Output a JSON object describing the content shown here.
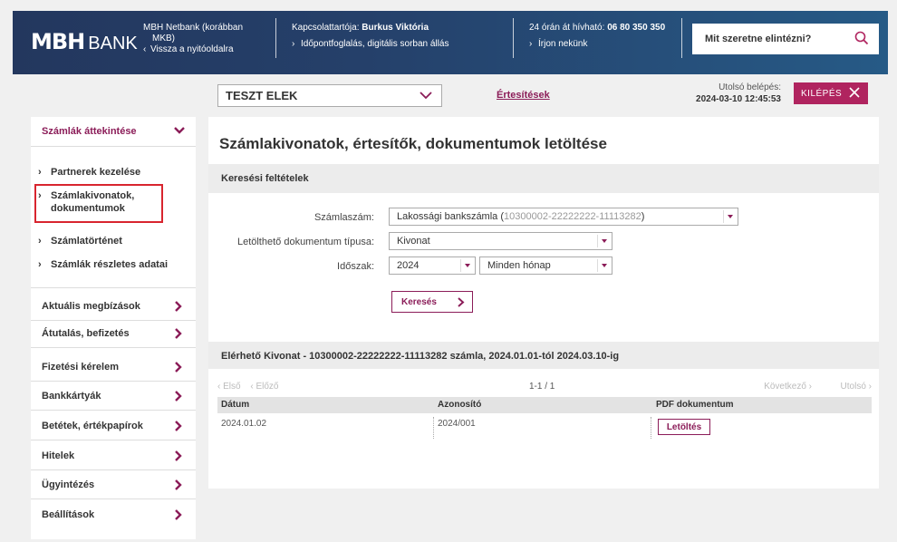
{
  "header": {
    "logo_mbh": "MBH",
    "logo_bank": "BANK",
    "netbank_line1": "MBH Netbank (korábban",
    "netbank_line2": "MKB)",
    "back_link": "Vissza a nyitóoldalra",
    "contact_label": "Kapcsolattartója:",
    "contact_name": "Burkus Viktória",
    "appointment_link": "Időpontfoglalás, digitális sorban állás",
    "hotline_label": "24 órán át hívható:",
    "hotline_number": "06 80 350 350",
    "write_link": "Írjon nekünk",
    "search_placeholder": "Mit szeretne elintézni?"
  },
  "topbar": {
    "user": "TESZT ELEK",
    "notifications": "Értesítések",
    "last_login_label": "Utolsó belépés:",
    "last_login_value": "2024-03-10 12:45:53",
    "logout": "KILÉPÉS"
  },
  "sidebar": {
    "accounts_overview": "Számlák áttekintése",
    "sub": [
      "Partnerek kezelése",
      "Számlakivonatok,",
      "dokumentumok",
      "Számlatörténet",
      "Számlák részletes adatai"
    ],
    "items": [
      "Aktuális megbízások",
      "Átutalás, befizetés",
      "Fizetési kérelem",
      "Bankkártyák",
      "Betétek, értékpapírok",
      "Hitelek",
      "Ügyintézés",
      "Beállítások"
    ]
  },
  "main": {
    "title": "Számlakivonatok, értesítők, dokumentumok letöltése",
    "search_section": "Keresési feltételek",
    "account_label": "Számlaszám:",
    "account_value_main": "Lakossági bankszámla (",
    "account_value_num": "10300002-22222222-11113282",
    "account_value_end": ")",
    "doctype_label": "Letölthető dokumentum típusa:",
    "doctype_value": "Kivonat",
    "period_label": "Időszak:",
    "year_value": "2024",
    "month_value": "Minden hónap",
    "search_button": "Keresés",
    "results_title": "Elérhető Kivonat - 10300002-22222222-11113282 számla, 2024.01.01-tól 2024.03.10-ig",
    "pager": {
      "first": "Első",
      "prev": "Előző",
      "count": "1-1 / 1",
      "next": "Következő",
      "last": "Utolsó"
    },
    "table": {
      "headers": [
        "Dátum",
        "Azonosító",
        "PDF dokumentum"
      ],
      "rows": [
        {
          "date": "2024.01.02",
          "id": "2024/001",
          "action": "Letöltés"
        }
      ]
    }
  }
}
